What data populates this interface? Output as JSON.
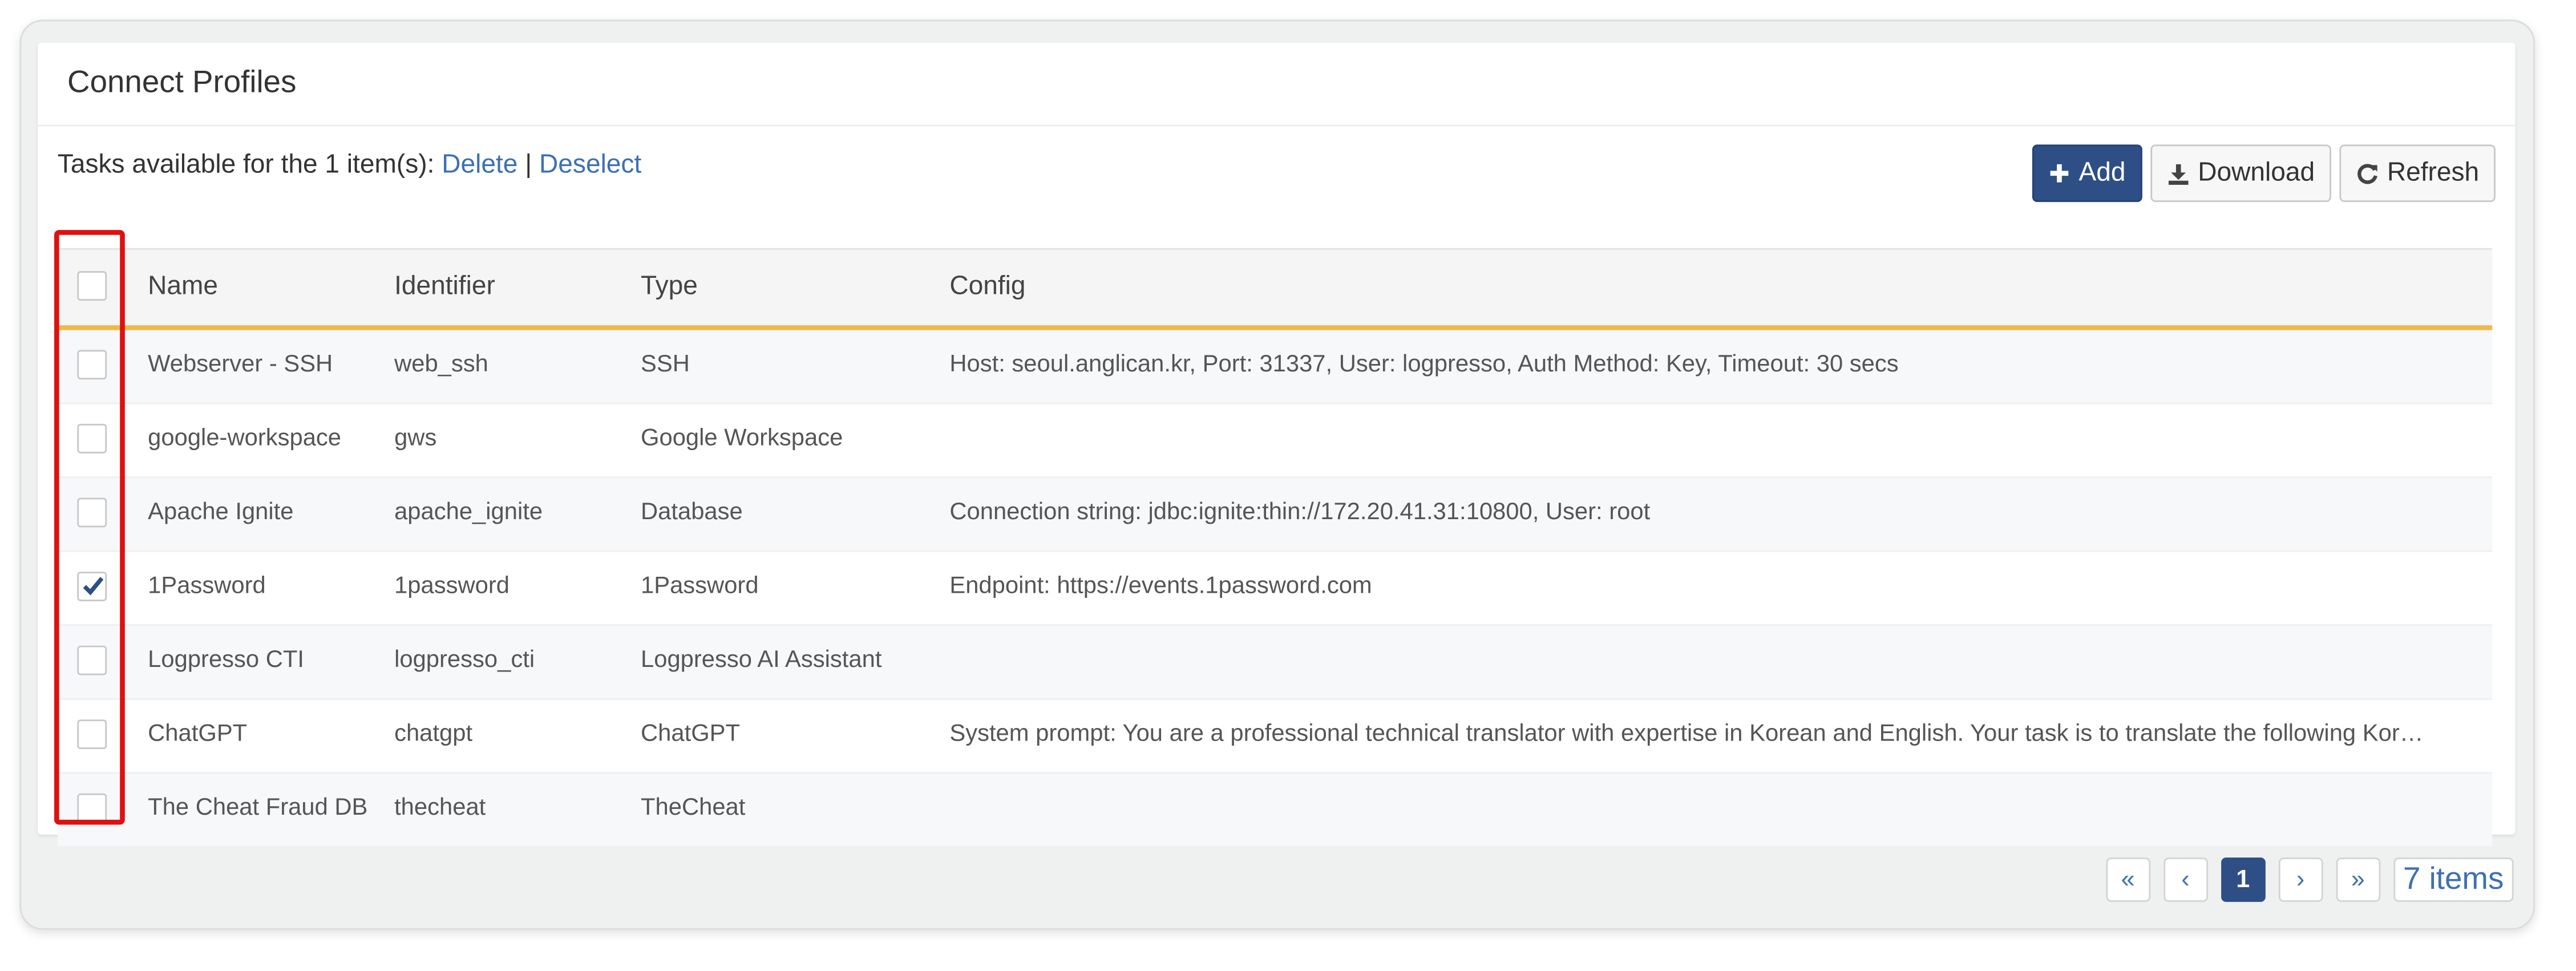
{
  "panel": {
    "title": "Connect Profiles"
  },
  "tasks": {
    "prefix": "Tasks available for the 1 item(s):",
    "delete_label": "Delete",
    "separator": "|",
    "deselect_label": "Deselect"
  },
  "toolbar": {
    "add_label": "Add",
    "download_label": "Download",
    "refresh_label": "Refresh"
  },
  "table": {
    "columns": [
      "Name",
      "Identifier",
      "Type",
      "Config"
    ],
    "rows": [
      {
        "name": "Webserver - SSH",
        "identifier": "web_ssh",
        "type": "SSH",
        "config": "Host: seoul.anglican.kr, Port: 31337, User: logpresso, Auth Method: Key, Timeout: 30 secs",
        "checked": false
      },
      {
        "name": "google-workspace",
        "identifier": "gws",
        "type": "Google Workspace",
        "config": "",
        "checked": false
      },
      {
        "name": "Apache Ignite",
        "identifier": "apache_ignite",
        "type": "Database",
        "config": "Connection string: jdbc:ignite:thin://172.20.41.31:10800, User: root",
        "checked": false
      },
      {
        "name": "1Password",
        "identifier": "1password",
        "type": "1Password",
        "config": "Endpoint: https://events.1password.com",
        "checked": true
      },
      {
        "name": "Logpresso CTI",
        "identifier": "logpresso_cti",
        "type": "Logpresso AI Assistant",
        "config": "",
        "checked": false
      },
      {
        "name": "ChatGPT",
        "identifier": "chatgpt",
        "type": "ChatGPT",
        "config": "System prompt: You are a professional technical translator with expertise in Korean and English. Your task is to translate the following Kor…",
        "checked": false
      },
      {
        "name": "The Cheat Fraud DB",
        "identifier": "thecheat",
        "type": "TheCheat",
        "config": "",
        "checked": false
      }
    ]
  },
  "pagination": {
    "first_symbol": "«",
    "prev_symbol": "‹",
    "current_page": "1",
    "next_symbol": "›",
    "last_symbol": "»",
    "count_label": "7 items"
  },
  "colors": {
    "primary": "#2d4f86",
    "link": "#3d70b2",
    "header_underline": "#f0b94a",
    "highlight": "#e01010"
  }
}
